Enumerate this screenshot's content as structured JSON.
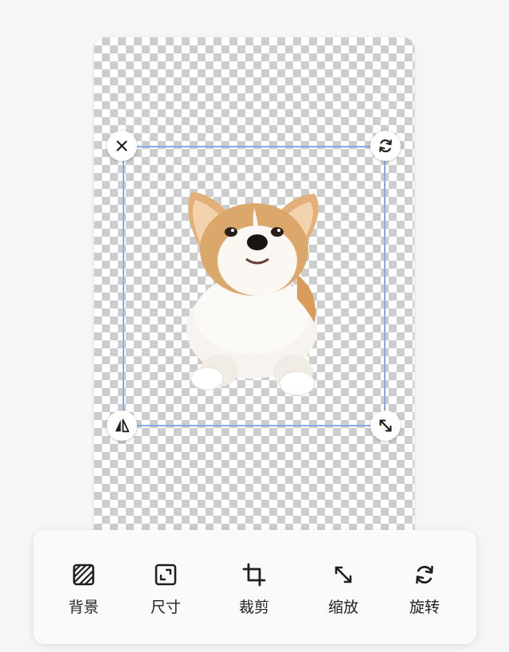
{
  "canvas": {
    "background": "transparent-checkerboard",
    "subject": "corgi-dog-cutout"
  },
  "handles": {
    "top_left": "close-icon",
    "top_right": "rotate-icon",
    "bottom_left": "flip-icon",
    "bottom_right": "resize-diagonal-icon"
  },
  "toolbar": {
    "items": [
      {
        "label": "背景",
        "icon": "background-hatch-icon"
      },
      {
        "label": "尺寸",
        "icon": "size-frame-icon"
      },
      {
        "label": "裁剪",
        "icon": "crop-icon"
      },
      {
        "label": "缩放",
        "icon": "scale-arrows-icon"
      },
      {
        "label": "旋转",
        "icon": "rotate-icon"
      }
    ]
  },
  "colors": {
    "selection_border": "#89a9e8",
    "toolbar_bg": "#fafafa",
    "icon": "#1f1f1f"
  }
}
